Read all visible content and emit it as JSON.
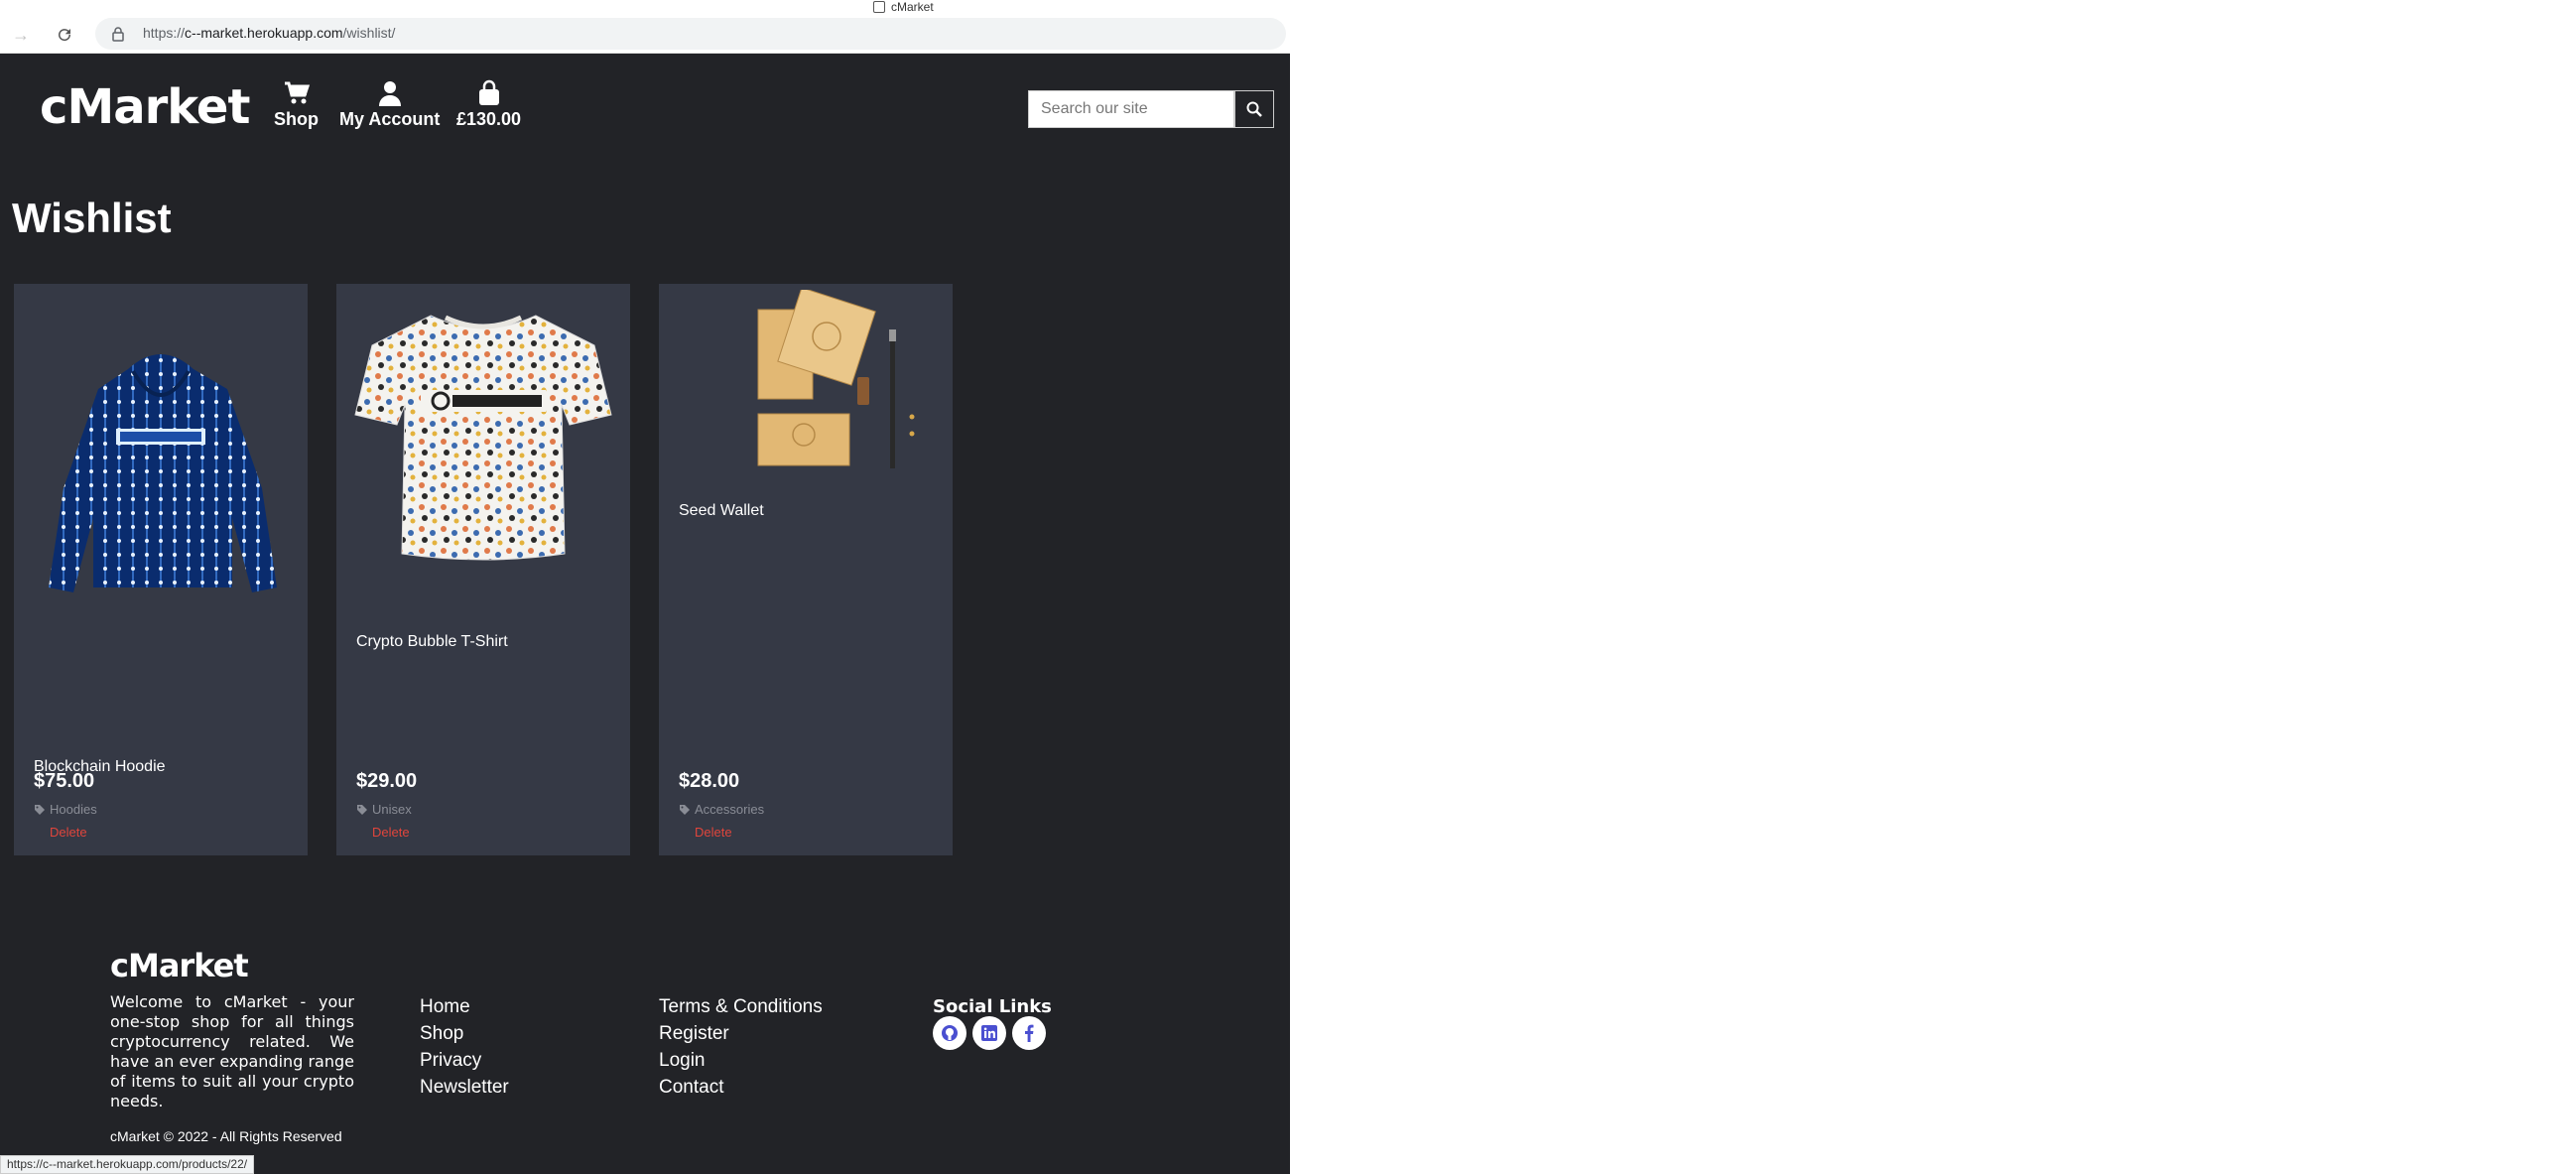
{
  "browser": {
    "tab_title": "cMarket",
    "url_prefix": "https://",
    "url_host": "c--market.herokuapp.com",
    "url_path": "/wishlist/",
    "status_url": "https://c--market.herokuapp.com/products/22/"
  },
  "header": {
    "logo": "cMarket",
    "nav": {
      "shop": "Shop",
      "account": "My Account",
      "cart": "£130.00"
    },
    "search_placeholder": "Search our site"
  },
  "page_title": "Wishlist",
  "items": [
    {
      "name": "Blockchain Hoodie",
      "price": "$75.00",
      "category": "Hoodies",
      "delete": "Delete"
    },
    {
      "name": "Crypto Bubble T-Shirt",
      "price": "$29.00",
      "category": "Unisex",
      "delete": "Delete"
    },
    {
      "name": "Seed Wallet",
      "price": "$28.00",
      "category": "Accessories",
      "delete": "Delete"
    }
  ],
  "footer": {
    "logo": "cMarket",
    "about": "Welcome to cMarket - your one-stop shop for all things cryptocurrency related. We have an ever expanding range of items to suit all your crypto needs.",
    "copyright": "cMarket © 2022 - All Rights Reserved",
    "links_col1": [
      "Home",
      "Shop",
      "Privacy",
      "Newsletter"
    ],
    "links_col2": [
      "Terms & Conditions",
      "Register",
      "Login",
      "Contact"
    ],
    "social_title": "Social Links",
    "social_icons": [
      "github-icon",
      "linkedin-icon",
      "facebook-icon"
    ]
  },
  "colors": {
    "page_bg": "#222327",
    "card_bg": "#353945",
    "delete": "#e0453c",
    "social_icon": "#4a4fd0"
  }
}
